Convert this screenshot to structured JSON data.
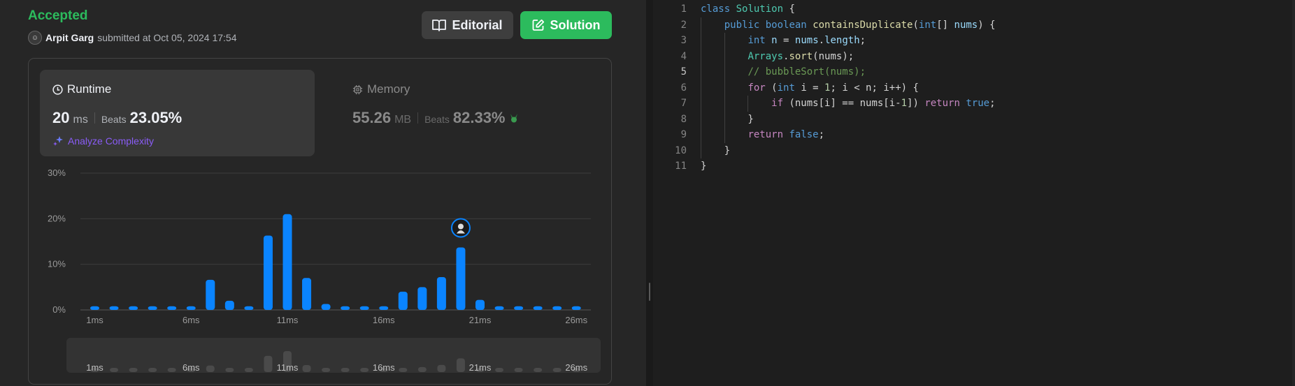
{
  "submission": {
    "status": "Accepted",
    "user": "Arpit Garg",
    "submitted_text": "submitted at Oct 05, 2024 17:54"
  },
  "buttons": {
    "editorial": "Editorial",
    "solution": "Solution"
  },
  "runtime": {
    "title": "Runtime",
    "value": "20",
    "unit": "ms",
    "beats_label": "Beats",
    "beats_value": "23.05%",
    "analyze": "Analyze Complexity"
  },
  "memory": {
    "title": "Memory",
    "value": "55.26",
    "unit": "MB",
    "beats_label": "Beats",
    "beats_value": "82.33%"
  },
  "colors": {
    "accent_green": "#2cbb5d",
    "bar_blue": "#0a84ff",
    "analyze_purple": "#8a5cf6"
  },
  "chart_data": {
    "type": "bar",
    "x": [
      "1ms",
      "2ms",
      "3ms",
      "4ms",
      "5ms",
      "6ms",
      "7ms",
      "8ms",
      "9ms",
      "10ms",
      "11ms",
      "12ms",
      "13ms",
      "14ms",
      "15ms",
      "16ms",
      "17ms",
      "18ms",
      "19ms",
      "20ms",
      "21ms",
      "22ms",
      "23ms",
      "24ms",
      "25ms",
      "26ms"
    ],
    "values": [
      0.8,
      0.8,
      0.8,
      0.8,
      0.8,
      0.8,
      6.6,
      2.0,
      0.8,
      16.3,
      21.0,
      7.0,
      1.3,
      0.8,
      0.8,
      0.8,
      4.0,
      5.0,
      7.2,
      13.7,
      2.2,
      0.8,
      0.8,
      0.8,
      0.8,
      0.8
    ],
    "highlight_index": 19,
    "y_ticks": [
      "0%",
      "10%",
      "20%",
      "30%"
    ],
    "x_ticks": [
      "1ms",
      "6ms",
      "11ms",
      "16ms",
      "21ms",
      "26ms"
    ],
    "ylim": [
      0,
      30
    ],
    "grid": true
  },
  "editor": {
    "lines": [
      {
        "n": "1",
        "tokens": [
          [
            "kw",
            "class"
          ],
          [
            "pl",
            " "
          ],
          [
            "ty",
            "Solution"
          ],
          [
            "pl",
            " {"
          ]
        ]
      },
      {
        "n": "2",
        "tokens": [
          [
            "pl",
            "    "
          ],
          [
            "kw",
            "public"
          ],
          [
            "pl",
            " "
          ],
          [
            "kw",
            "boolean"
          ],
          [
            "pl",
            " "
          ],
          [
            "fn",
            "containsDuplicate"
          ],
          [
            "pl",
            "("
          ],
          [
            "kw",
            "int"
          ],
          [
            "pl",
            "[] "
          ],
          [
            "id",
            "nums"
          ],
          [
            "pl",
            ") {"
          ]
        ]
      },
      {
        "n": "3",
        "tokens": [
          [
            "pl",
            "        "
          ],
          [
            "kw",
            "int"
          ],
          [
            "pl",
            " "
          ],
          [
            "id",
            "n"
          ],
          [
            "pl",
            " = "
          ],
          [
            "id",
            "nums"
          ],
          [
            "pl",
            "."
          ],
          [
            "id",
            "length"
          ],
          [
            "pl",
            ";"
          ]
        ]
      },
      {
        "n": "4",
        "tokens": [
          [
            "pl",
            "        "
          ],
          [
            "ty",
            "Arrays"
          ],
          [
            "pl",
            "."
          ],
          [
            "fn",
            "sort"
          ],
          [
            "pl",
            "(nums);"
          ]
        ]
      },
      {
        "n": "5",
        "tokens": [
          [
            "pl",
            "        "
          ],
          [
            "cm",
            "// bubbleSort(nums);"
          ]
        ]
      },
      {
        "n": "6",
        "tokens": [
          [
            "pl",
            "        "
          ],
          [
            "kw2",
            "for"
          ],
          [
            "pl",
            " ("
          ],
          [
            "kw",
            "int"
          ],
          [
            "pl",
            " i = "
          ],
          [
            "nm",
            "1"
          ],
          [
            "pl",
            "; i < n; i++) {"
          ]
        ]
      },
      {
        "n": "7",
        "tokens": [
          [
            "pl",
            "            "
          ],
          [
            "kw2",
            "if"
          ],
          [
            "pl",
            " (nums[i] == nums[i-"
          ],
          [
            "nm",
            "1"
          ],
          [
            "pl",
            "]) "
          ],
          [
            "kw2",
            "return"
          ],
          [
            "pl",
            " "
          ],
          [
            "kw",
            "true"
          ],
          [
            "pl",
            ";"
          ]
        ]
      },
      {
        "n": "8",
        "tokens": [
          [
            "pl",
            "        }"
          ]
        ]
      },
      {
        "n": "9",
        "tokens": [
          [
            "pl",
            "        "
          ],
          [
            "kw2",
            "return"
          ],
          [
            "pl",
            " "
          ],
          [
            "kw",
            "false"
          ],
          [
            "pl",
            ";"
          ]
        ]
      },
      {
        "n": "10",
        "tokens": [
          [
            "pl",
            "    }"
          ]
        ]
      },
      {
        "n": "11",
        "tokens": [
          [
            "pl",
            "}"
          ]
        ]
      }
    ],
    "active_line": "5"
  }
}
